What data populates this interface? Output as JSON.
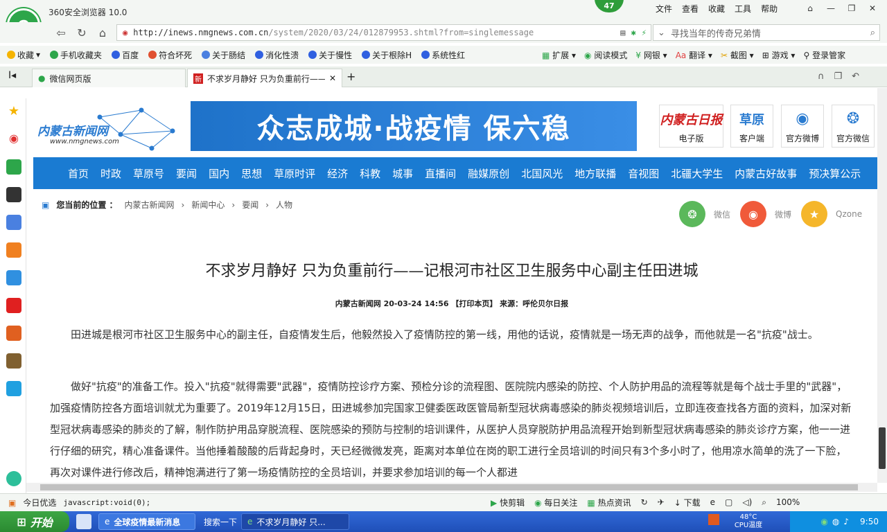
{
  "browser": {
    "name": "360安全浏览器 10.0",
    "badge": "47",
    "menu": [
      "文件",
      "查看",
      "收藏",
      "工具",
      "帮助"
    ],
    "url_host": "http://inews.nmgnews.com.cn",
    "url_path": "/system/2020/03/24/012879953.shtml?from=singlemessage",
    "search_placeholder": "寻找当年的传奇兄弟情",
    "bookmarks": [
      "收藏",
      "手机收藏夹",
      "百度",
      "符合坏死",
      "关于肠结",
      "消化性溃",
      "关于慢性",
      "关于根除H",
      "系统性红"
    ],
    "tools": [
      "扩展",
      "阅读模式",
      "网银",
      "翻译",
      "截图",
      "游戏",
      "登录管家"
    ],
    "tabs": [
      "微信网页版",
      "不求岁月静好 只为负重前行——"
    ]
  },
  "site": {
    "logo_text": "内蒙古新闻网",
    "logo_url": "www.nmgnews.com",
    "banner": "众志成城·战疫情 保六稳",
    "quick_links": [
      {
        "icon": "内蒙古日报",
        "label": "电子版"
      },
      {
        "icon": "草原",
        "label": "客户端"
      },
      {
        "icon": "微博",
        "label": "官方微博"
      },
      {
        "icon": "微信",
        "label": "官方微信"
      }
    ],
    "nav": [
      "首页",
      "时政",
      "草原号",
      "要闻",
      "国内",
      "思想",
      "草原时评",
      "经济",
      "科教",
      "城事",
      "直播间",
      "融媒原创",
      "北国风光",
      "地方联播",
      "音视图",
      "北疆大学生",
      "内蒙古好故事",
      "预决算公示"
    ],
    "breadcrumb_label": "您当前的位置 ：",
    "breadcrumb": [
      "内蒙古新闻网",
      "新闻中心",
      "要闻",
      "人物"
    ],
    "share": [
      "微信",
      "微博",
      "Qzone"
    ]
  },
  "article": {
    "title": "不求岁月静好 只为负重前行——记根河市社区卫生服务中心副主任田进城",
    "meta": "内蒙古新闻网 20-03-24 14:56 【打印本页】 来源：呼伦贝尔日报",
    "paragraphs": [
      "田进城是根河市社区卫生服务中心的副主任，自疫情发生后，他毅然投入了疫情防控的第一线，用他的话说，疫情就是一场无声的战争，而他就是一名\"抗疫\"战士。",
      "做好\"抗疫\"的准备工作。投入\"抗疫\"就得需要\"武器\"，疫情防控诊疗方案、预检分诊的流程图、医院院内感染的防控、个人防护用品的流程等就是每个战士手里的\"武器\"，加强疫情防控各方面培训就尤为重要了。2019年12月15日，田进城参加完国家卫健委医政医管局新型冠状病毒感染的肺炎视频培训后，立即连夜查找各方面的资料，加深对新型冠状病毒感染的肺炎的了解，制作防护用品穿脱流程、医院感染的预防与控制的培训课件，从医护人员穿脱防护用品流程开始到新型冠状病毒感染的肺炎诊疗方案，他一一进行仔细的研究，精心准备课件。当他捶着酸酸的后背起身时，天已经微微发亮，距离对本单位在岗的职工进行全员培训的时间只有3个多小时了，他用凉水简单的洗了一下脸，再次对课件进行修改后，精神饱满进行了第一场疫情防控的全员培训，并要求参加培训的每一个人都进"
    ]
  },
  "status": {
    "left": [
      "今日优选",
      "javascript:void(0);"
    ],
    "right": [
      "快剪辑",
      "每日关注",
      "热点资讯",
      "下载",
      "100%"
    ]
  },
  "taskbar": {
    "start": "开始",
    "tasks": [
      "全球疫情最新消息",
      "搜索一下",
      "不求岁月静好 只..."
    ],
    "temp": "48°C",
    "temp_label": "CPU温度",
    "time": "9:50"
  },
  "colors": {
    "nav_blue": "#1a7bd2",
    "brand_green": "#2da64a",
    "taskbar_blue": "#2a5fcc"
  }
}
